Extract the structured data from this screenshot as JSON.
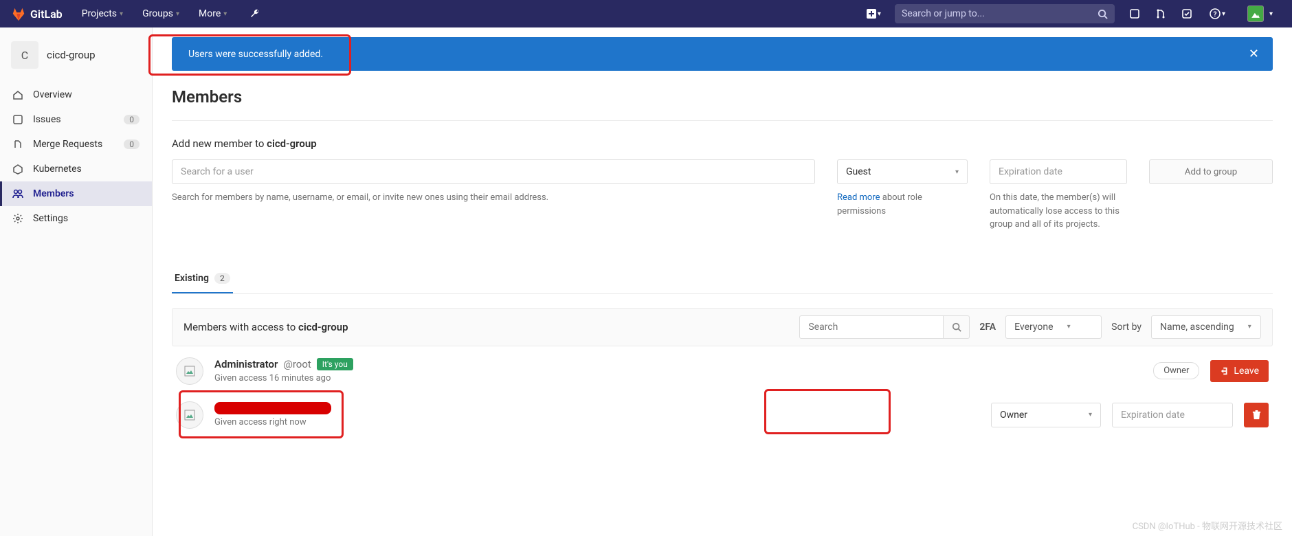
{
  "navbar": {
    "brand": "GitLab",
    "menus": {
      "projects": "Projects",
      "groups": "Groups",
      "more": "More"
    },
    "search_placeholder": "Search or jump to..."
  },
  "sidebar": {
    "group_initial": "C",
    "group_name": "cicd-group",
    "items": [
      {
        "label": "Overview"
      },
      {
        "label": "Issues",
        "badge": "0"
      },
      {
        "label": "Merge Requests",
        "badge": "0"
      },
      {
        "label": "Kubernetes"
      },
      {
        "label": "Members"
      },
      {
        "label": "Settings"
      }
    ]
  },
  "alert": {
    "message": "Users were successfully added."
  },
  "page": {
    "title": "Members",
    "add_prefix": "Add new member to ",
    "add_group": "cicd-group",
    "user_placeholder": "Search for a user",
    "user_help": "Search for members by name, username, or email, or invite new ones using their email address.",
    "role_selected": "Guest",
    "role_link": "Read more",
    "role_help_suffix": " about role permissions",
    "exp_placeholder": "Expiration date",
    "exp_help": "On this date, the member(s) will automatically lose access to this group and all of its projects.",
    "add_button": "Add to group"
  },
  "tabs": {
    "existing": "Existing",
    "count": "2"
  },
  "filter": {
    "access_prefix": "Members with access to ",
    "access_group": "cicd-group",
    "search_placeholder": "Search",
    "twofa_label": "2FA",
    "twofa_value": "Everyone",
    "sortby_label": "Sort by",
    "sortby_value": "Name, ascending"
  },
  "members": [
    {
      "name": "Administrator",
      "handle": "@root",
      "you_badge": "It's you",
      "sub": "Given access 16 minutes ago",
      "role_pill": "Owner",
      "leave_label": "Leave"
    },
    {
      "sub": "Given access right now",
      "role_select": "Owner",
      "exp_placeholder": "Expiration date"
    }
  ],
  "watermark": "CSDN @IoTHub - 物联网开源技术社区"
}
